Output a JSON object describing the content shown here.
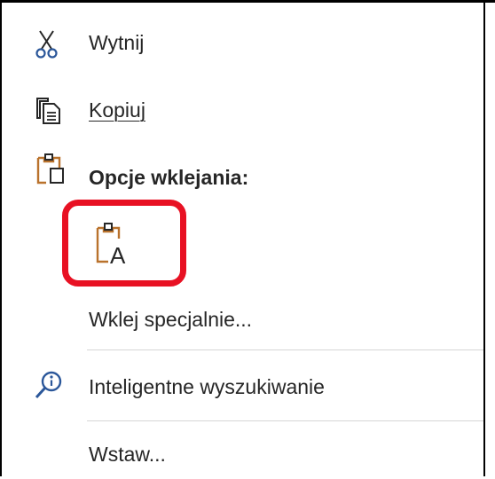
{
  "menu": {
    "cut": {
      "label": "Wytnij"
    },
    "copy": {
      "label": "Kopiuj"
    },
    "paste_options": {
      "label": "Opcje wklejania:"
    },
    "paste_special": {
      "label": "Wklej specjalnie..."
    },
    "smart_lookup": {
      "label": "Inteligentne wyszukiwanie"
    },
    "insert": {
      "label": "Wstaw..."
    }
  },
  "icons": {
    "cut": "scissors-icon",
    "copy": "copy-icon",
    "paste_options": "clipboard-icon",
    "keep_text_only": "paste-text-only-icon",
    "smart_lookup": "smart-lookup-icon"
  },
  "colors": {
    "accent_blue": "#2b579a",
    "clipboard_orange": "#b9722c",
    "highlight_red": "#e81123",
    "text": "#262626"
  }
}
